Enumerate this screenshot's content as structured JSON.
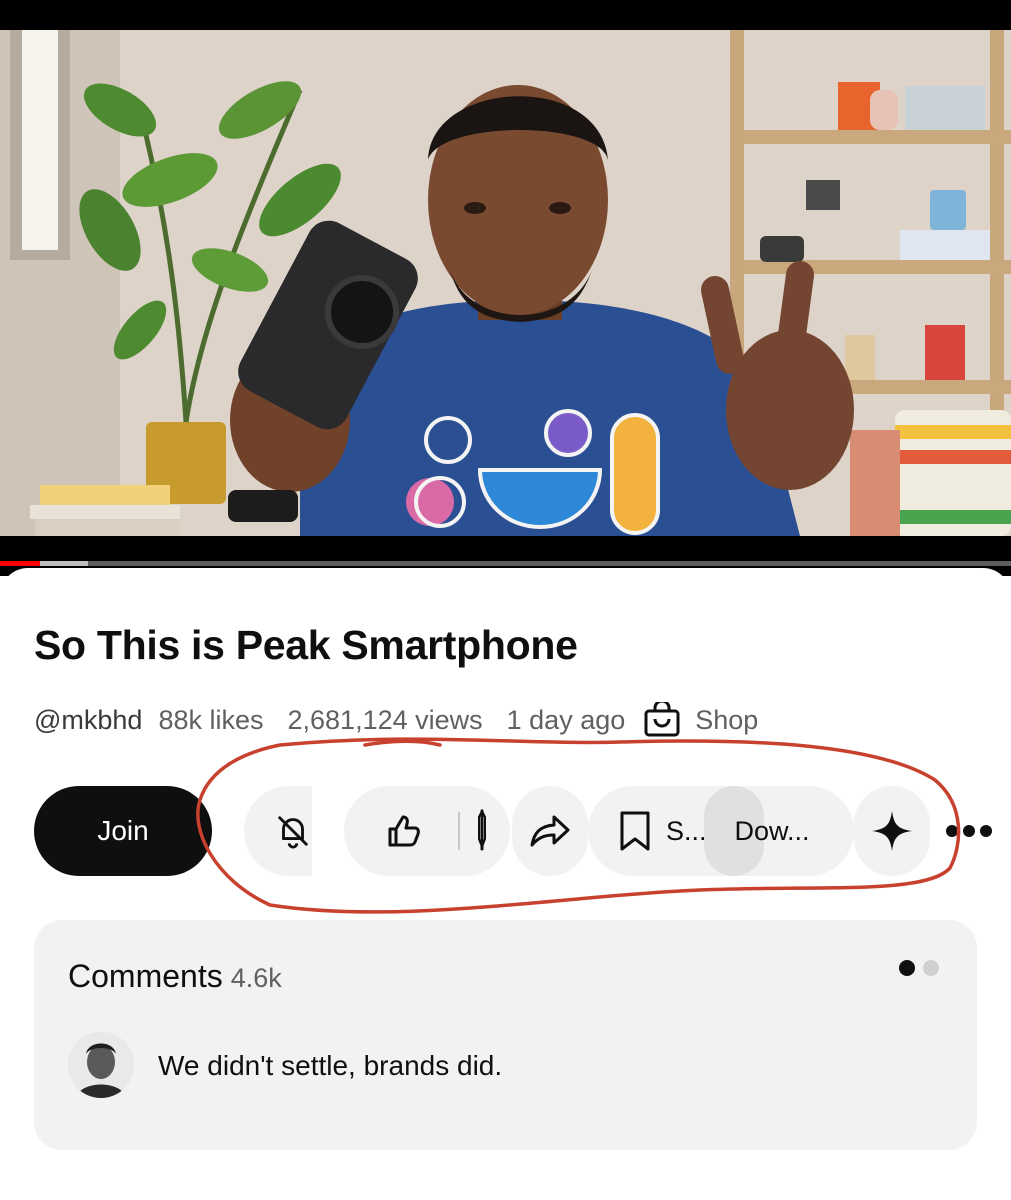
{
  "video": {
    "progress_fraction": 0.04,
    "buffered_fraction": 0.087,
    "shirt_colors": [
      "#f3b23e",
      "#2e88d8",
      "#d96aa6",
      "#7a5bc8"
    ]
  },
  "details": {
    "title": "So This is Peak Smartphone",
    "channel_handle": "@mkbhd",
    "likes": "88k likes",
    "views": "2,681,124 views",
    "age": "1 day ago",
    "shop_label": "Shop"
  },
  "actions": {
    "join_label": "Join",
    "save_label": "S...",
    "download_label": "Dow..."
  },
  "comments": {
    "heading": "Comments",
    "count": "4.6k",
    "top_comment": "We didn't settle, brands did."
  },
  "colors": {
    "annotation": "#c8412e",
    "progress": "#ff0000",
    "page_dot_active": "#0f0f0f",
    "page_dot_inactive": "#d0d0d0"
  },
  "icons": [
    "notifications-off-icon",
    "thumbs-up-icon",
    "thumbs-down-icon",
    "share-icon",
    "bookmark-icon",
    "sparkle-icon",
    "more-icon",
    "shopping-bag-icon"
  ]
}
